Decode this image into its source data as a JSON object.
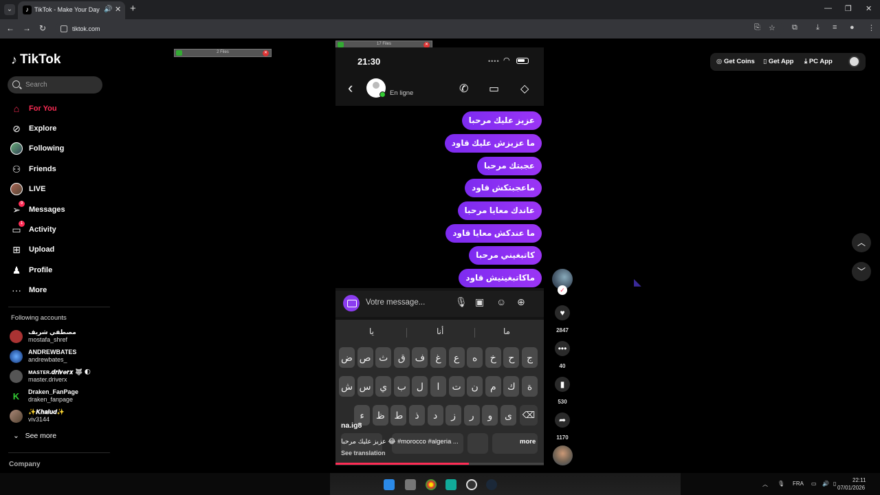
{
  "browser": {
    "tab_title": "TikTok - Make Your Day",
    "url": "tiktok.com",
    "tab_close": "✕",
    "new_tab": "+",
    "win_min": "—",
    "win_max": "❐",
    "win_close": "✕"
  },
  "sidebar": {
    "logo_text": "TikTok",
    "search_placeholder": "Search",
    "nav": [
      {
        "label": "For You",
        "icon": "home-icon"
      },
      {
        "label": "Explore",
        "icon": "compass-icon"
      },
      {
        "label": "Following",
        "icon": "following-avatar-icon"
      },
      {
        "label": "Friends",
        "icon": "friends-icon"
      },
      {
        "label": "LIVE",
        "icon": "live-avatar-icon"
      },
      {
        "label": "Messages",
        "icon": "messages-icon",
        "badge": "9"
      },
      {
        "label": "Activity",
        "icon": "activity-icon",
        "badge": "1"
      },
      {
        "label": "Upload",
        "icon": "upload-icon"
      },
      {
        "label": "Profile",
        "icon": "profile-icon"
      },
      {
        "label": "More",
        "icon": "more-icon"
      }
    ],
    "following_title": "Following accounts",
    "accounts": [
      {
        "name": "مصطفي شريف",
        "handle": "mostafa_shref"
      },
      {
        "name": "ANDREWBATES",
        "handle": "andrewbates_"
      },
      {
        "name": "ᴍᴀsᴛᴇʀ.𝒅𝒓𝒊𝒗𝒆𝒓𝒙 🐺 🌓",
        "handle": "master.driverx"
      },
      {
        "name": "Draken_FanPage",
        "handle": "draken_fanpage"
      },
      {
        "name": "✨𝑲𝒉𝒂𝒍𝒖𝒅✨",
        "handle": "viv3144"
      }
    ],
    "see_more": "See more",
    "company": "Company"
  },
  "overlays": {
    "left_files": "2 Files",
    "center_files": "17 Files"
  },
  "topright": {
    "get_coins": "Get Coins",
    "get_app": "Get App",
    "pc_app": "PC App"
  },
  "video": {
    "time": "21:30",
    "status_text": "En ligne",
    "messages": [
      "عزيز عليك مرحبا",
      "ما عزيزش عليك قاود",
      "عجبتك مرحبا",
      "ماعجبتكش قاود",
      "عاندك معايا مرحبا",
      "ما عندكش معايا قاود",
      "كاتبغيني مرحبا",
      "ماكاتبغينيش قاود"
    ],
    "composer_placeholder": "Votre message...",
    "suggestions": [
      "ما",
      "أنا",
      "يا"
    ],
    "key_rows": [
      [
        "ج",
        "ح",
        "خ",
        "ه",
        "ع",
        "غ",
        "ف",
        "ق",
        "ث",
        "ص",
        "ض"
      ],
      [
        "ة",
        "ك",
        "م",
        "ن",
        "ت",
        "ا",
        "ل",
        "ب",
        "ي",
        "س",
        "ش"
      ],
      [
        "ى",
        "و",
        "ر",
        "ز",
        "د",
        "ذ",
        "ط",
        "ظ",
        "ء"
      ]
    ],
    "username": "na.ig8",
    "caption": "عزيز عليك مرحبا 😂 #morocco #algeria ...",
    "caption_more": "more",
    "see_translation": "See translation",
    "progress": 0.64
  },
  "actions": {
    "likes": "2847",
    "comments": "40",
    "saves": "530",
    "shares": "1170"
  },
  "taskbar": {
    "lang": "FRA",
    "time": "22:11",
    "date": "07/01/2026"
  }
}
